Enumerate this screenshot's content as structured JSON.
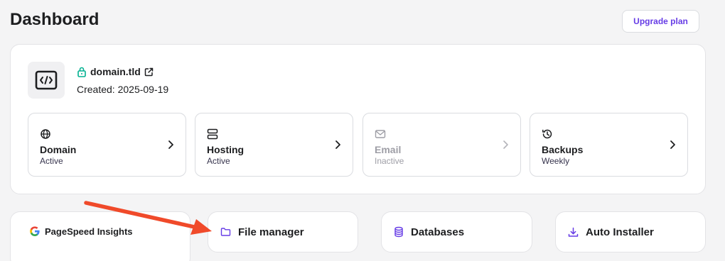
{
  "header": {
    "title": "Dashboard",
    "upgrade_label": "Upgrade plan"
  },
  "site": {
    "domain": "domain.tld",
    "created": "Created: 2025-09-19"
  },
  "tiles": [
    {
      "title": "Domain",
      "status": "Active",
      "icon": "globe-icon"
    },
    {
      "title": "Hosting",
      "status": "Active",
      "icon": "server-icon"
    },
    {
      "title": "Email",
      "status": "Inactive",
      "icon": "mail-icon"
    },
    {
      "title": "Backups",
      "status": "Weekly",
      "icon": "history-icon"
    }
  ],
  "tools": {
    "pagespeed": "PageSpeed Insights",
    "file_manager": "File manager",
    "databases": "Databases",
    "auto_installer": "Auto Installer"
  },
  "colors": {
    "accent": "#673de6",
    "success": "#00b090",
    "annotation_arrow": "#f04a2a",
    "background": "#f4f4f5"
  }
}
